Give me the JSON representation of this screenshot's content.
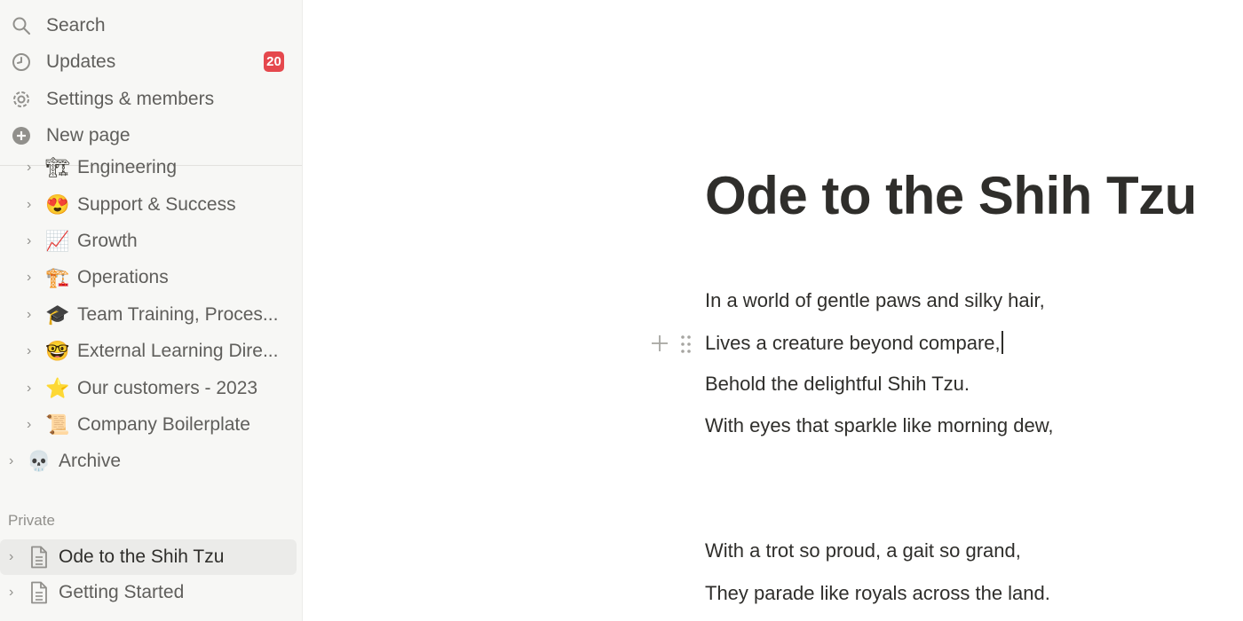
{
  "sidebar": {
    "top": {
      "search": "Search",
      "updates": "Updates",
      "updates_badge": "20",
      "settings": "Settings & members",
      "new_page": "New page"
    },
    "tree": [
      {
        "emoji": "🏗",
        "label": "Engineering"
      },
      {
        "emoji": "😍",
        "label": "Support & Success"
      },
      {
        "emoji": "📈",
        "label": "Growth"
      },
      {
        "emoji": "🏗️",
        "label": "Operations"
      },
      {
        "emoji": "🎓",
        "label": "Team Training, Proces..."
      },
      {
        "emoji": "🤓",
        "label": "External Learning Dire..."
      },
      {
        "emoji": "⭐",
        "label": "Our customers - 2023"
      },
      {
        "emoji": "📜",
        "label": "Company Boilerplate"
      },
      {
        "emoji": "💀",
        "label": "Archive"
      }
    ],
    "private_label": "Private",
    "private": [
      {
        "label": "Ode to the Shih Tzu"
      },
      {
        "label": "Getting Started"
      }
    ]
  },
  "page": {
    "title": "Ode to the Shih Tzu",
    "lines": [
      "In a world of gentle paws and silky hair,",
      "Lives a creature beyond compare,",
      "Behold the delightful Shih Tzu.",
      "With eyes that sparkle like morning dew,",
      "With a trot so proud, a gait so grand,",
      "They parade like royals across the land."
    ]
  }
}
